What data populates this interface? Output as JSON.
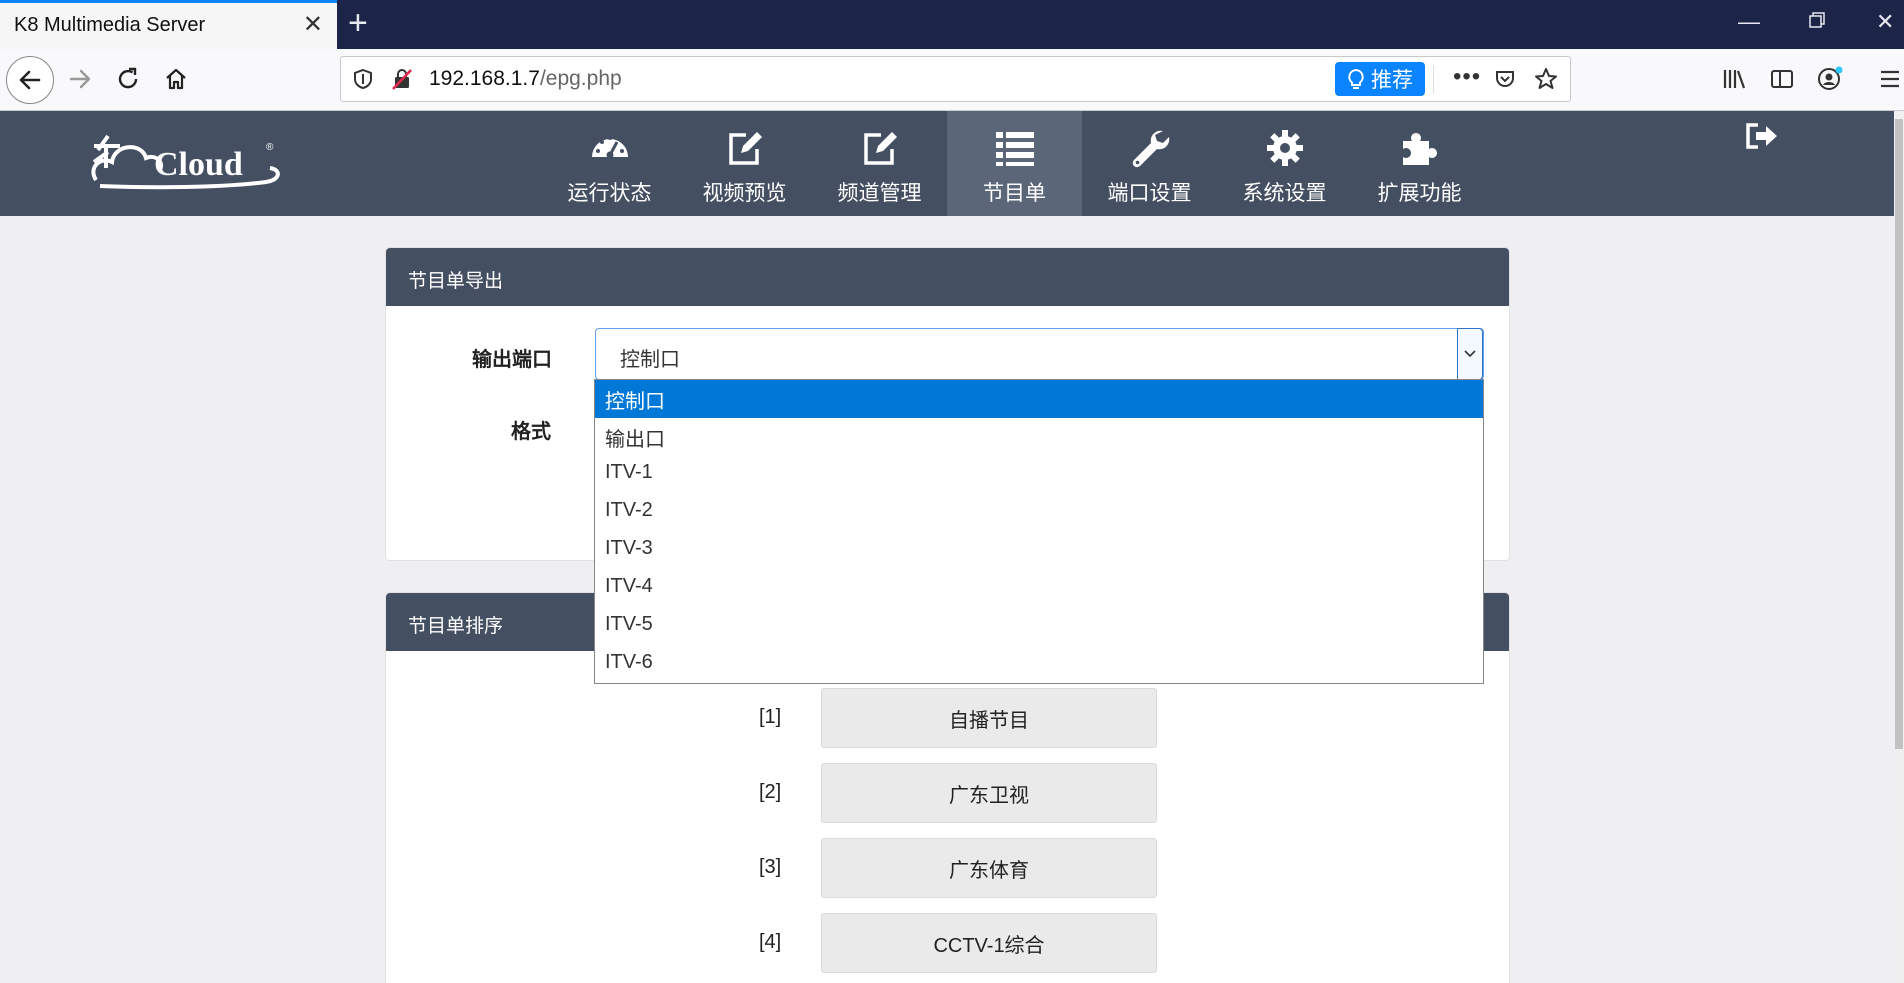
{
  "browser": {
    "tab_title": "K8 Multimedia Server",
    "url_host": "192.168.1.7",
    "url_path": "/epg.php",
    "recommend_label": "推荐",
    "accent_color": "#0a84ff"
  },
  "header": {
    "logo_text": "Cloud",
    "menu": [
      {
        "label": "运行状态",
        "icon": "dashboard-icon"
      },
      {
        "label": "视频预览",
        "icon": "edit-icon"
      },
      {
        "label": "频道管理",
        "icon": "edit-icon"
      },
      {
        "label": "节目单",
        "icon": "list-icon",
        "active": true
      },
      {
        "label": "端口设置",
        "icon": "wrench-icon"
      },
      {
        "label": "系统设置",
        "icon": "gear-icon"
      },
      {
        "label": "扩展功能",
        "icon": "puzzle-icon"
      }
    ],
    "bg_color": "#444f62",
    "active_color": "#5b6779"
  },
  "export_panel": {
    "title": "节目单导出",
    "output_port_label": "输出端口",
    "format_label": "格式",
    "selected": "控制口",
    "options": [
      "控制口",
      "输出口",
      "ITV-1",
      "ITV-2",
      "ITV-3",
      "ITV-4",
      "ITV-5",
      "ITV-6"
    ]
  },
  "order_panel": {
    "title": "节目单排序",
    "rows": [
      {
        "index": "[1]",
        "name": "自播节目"
      },
      {
        "index": "[2]",
        "name": "广东卫视"
      },
      {
        "index": "[3]",
        "name": "广东体育"
      },
      {
        "index": "[4]",
        "name": "CCTV-1综合"
      }
    ]
  }
}
